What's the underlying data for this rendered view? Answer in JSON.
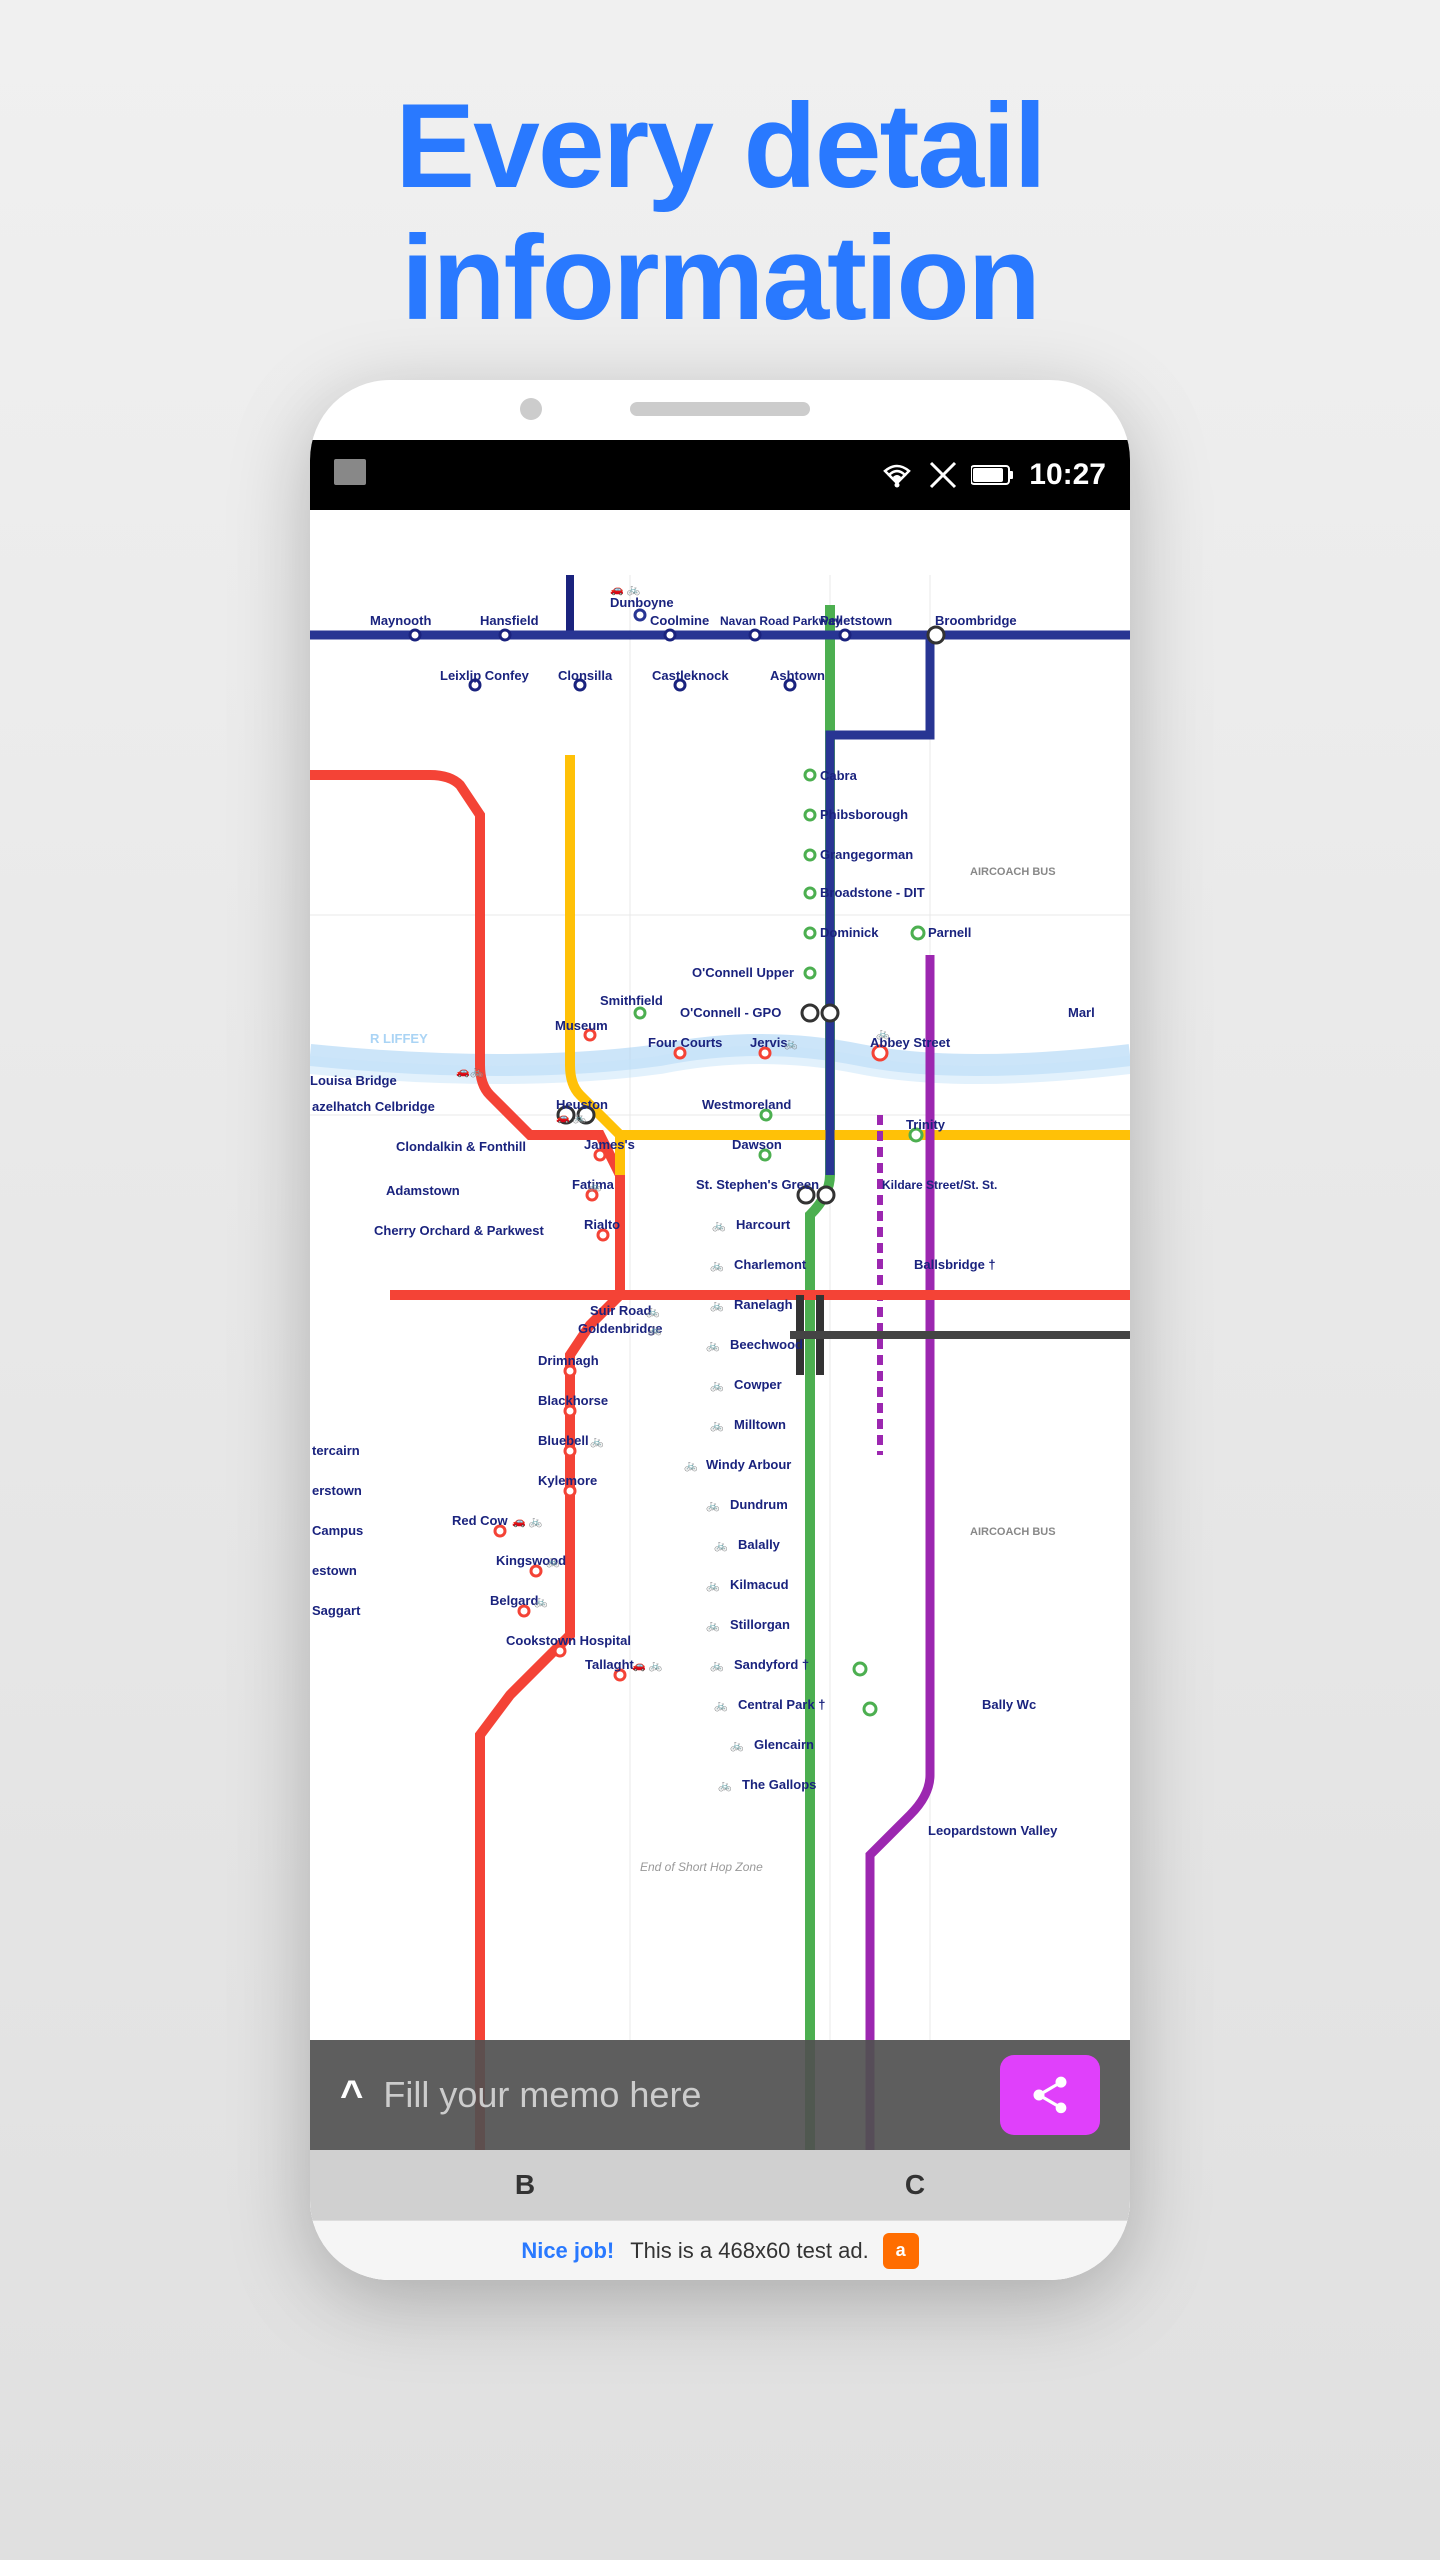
{
  "page": {
    "background_color": "#e8e8e8",
    "heading": {
      "line1": "Every detail",
      "line2": "information"
    }
  },
  "status_bar": {
    "time": "10:27",
    "bg_color": "#000000"
  },
  "memo_bar": {
    "placeholder": "Fill your memo here",
    "chevron": "^",
    "bg_color": "rgba(80,80,80,0.92)"
  },
  "share_button": {
    "bg_color": "#e040fb",
    "icon": "share-icon"
  },
  "keyboard_keys": [
    "B",
    "C"
  ],
  "ad_bar": {
    "nice_label": "Nice job!",
    "ad_text": "This is a 468x60 test ad.",
    "logo_label": "a"
  },
  "transit_map": {
    "stations": {
      "maynooth": "Maynooth",
      "hansfield": "Hansfield",
      "dunboyne": "Dunboyne",
      "coolmine": "Coolmine",
      "navan_road_parkway": "Navan Road Parkway",
      "pelletstown": "Pelletstown",
      "broombridge": "Broombridge",
      "leixlip_confey": "Leixlip Confey",
      "clonsilla": "Clonsilla",
      "castleknock": "Castleknock",
      "ashtown": "Ashtown",
      "louisa_bridge": "Louisa Bridge",
      "cabra": "Cabra",
      "phibsborough": "Phibsborough",
      "grangegorman": "Grangegorman",
      "broadstone": "Broadstone - DIT",
      "dominick": "Dominick",
      "parnell": "Parnell",
      "oconnell_upper": "O'Connell Upper",
      "oconnell_gpo": "O'Connell - GPO",
      "smithfield": "Smithfield",
      "museum": "Museum",
      "four_courts": "Four Courts",
      "jervis": "Jervis",
      "abbey_street": "Abbey Street",
      "heuston": "Heuston",
      "westmoreland": "Westmoreland",
      "james": "James's",
      "dawson": "Dawson",
      "fatima": "Fatima",
      "st_stephens_green": "St. Stephen's Green",
      "kildare": "Kildare Street/St. St.",
      "rialto": "Rialto",
      "harcourt": "Harcourt",
      "charlemont": "Charlemont",
      "ballsbridge": "Ballsbridge †",
      "ranelagh": "Ranelagh",
      "beechwood": "Beechwood",
      "cowper": "Cowper",
      "milltown": "Milltown",
      "windy_arbour": "Windy Arbour",
      "dundrum": "Dundrum",
      "balally": "Balally",
      "kilmacud": "Kilmacud",
      "stillorgan": "Stillorgan",
      "sandyford": "Sandyford †",
      "central_park": "Central Park †",
      "glencairn": "Glencairn",
      "gallops": "The Gallops",
      "leopardstown": "Leopardstown Valley",
      "suir_road": "Suir Road",
      "goldenbridge": "Goldenbridge",
      "drimnagh": "Drimnagh",
      "blackhorse": "Blackhorse",
      "bluebell": "Bluebell",
      "kylemore": "Kylemore",
      "red_cow": "Red Cow",
      "kingswood": "Kingswood",
      "belgard": "Belgard",
      "cookstown": "Cookstown Hospital",
      "tallaght": "Tallaght",
      "tercairn": "tercairn",
      "erstown": "erstown",
      "campus": "Campus",
      "estown": "estown",
      "saggart": "Saggart",
      "azelhatch": "azelhatch Celbridge",
      "clondalkin": "Clondalkin & Fonthill",
      "adamstown": "Adamstown",
      "cherry": "Cherry Orchard & Parkwest",
      "mari": "Marl",
      "trinity": "Trinity",
      "bally": "Bally Wc",
      "end_short_hop": "End of Short Hop Zone",
      "aircoach1": "AIRCOACH BUS",
      "aircoach2": "AIRCOACH BUS"
    }
  }
}
